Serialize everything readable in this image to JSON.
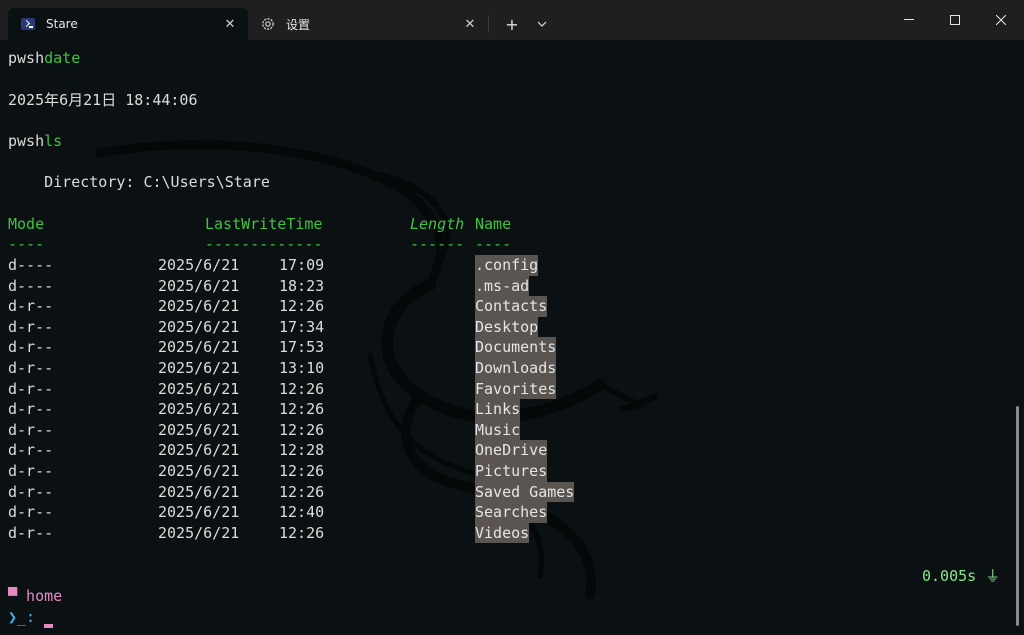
{
  "tabs": [
    {
      "title": "Stare",
      "icon": "powershell-icon"
    },
    {
      "title": "设置",
      "icon": "gear-icon"
    }
  ],
  "titlebar": {
    "new_tab": "+",
    "dropdown": "⌄"
  },
  "terminal": {
    "cmd1_prompt": "pwsh",
    "cmd1": "date",
    "date_output": "2025年6月21日 18:44:06",
    "cmd2_prompt": "pwsh",
    "cmd2": "ls",
    "directory_line": "    Directory: C:\\Users\\Stare",
    "headers": {
      "mode": "Mode",
      "lastwrite": "LastWriteTime",
      "length": "Length",
      "name": "Name"
    },
    "underlines": {
      "mode": "----",
      "lastwrite": "-------------",
      "length": "------",
      "name": "----"
    },
    "rows": [
      {
        "mode": "d----",
        "date": "2025/6/21",
        "time": "17:09",
        "name": ".config"
      },
      {
        "mode": "d----",
        "date": "2025/6/21",
        "time": "18:23",
        "name": ".ms-ad"
      },
      {
        "mode": "d-r--",
        "date": "2025/6/21",
        "time": "12:26",
        "name": "Contacts"
      },
      {
        "mode": "d-r--",
        "date": "2025/6/21",
        "time": "17:34",
        "name": "Desktop"
      },
      {
        "mode": "d-r--",
        "date": "2025/6/21",
        "time": "17:53",
        "name": "Documents"
      },
      {
        "mode": "d-r--",
        "date": "2025/6/21",
        "time": "13:10",
        "name": "Downloads"
      },
      {
        "mode": "d-r--",
        "date": "2025/6/21",
        "time": "12:26",
        "name": "Favorites"
      },
      {
        "mode": "d-r--",
        "date": "2025/6/21",
        "time": "12:26",
        "name": "Links"
      },
      {
        "mode": "d-r--",
        "date": "2025/6/21",
        "time": "12:26",
        "name": "Music"
      },
      {
        "mode": "d-r--",
        "date": "2025/6/21",
        "time": "12:28",
        "name": "OneDrive"
      },
      {
        "mode": "d-r--",
        "date": "2025/6/21",
        "time": "12:26",
        "name": "Pictures"
      },
      {
        "mode": "d-r--",
        "date": "2025/6/21",
        "time": "12:26",
        "name": "Saved Games"
      },
      {
        "mode": "d-r--",
        "date": "2025/6/21",
        "time": "12:40",
        "name": "Searches"
      },
      {
        "mode": "d-r--",
        "date": "2025/6/21",
        "time": "12:26",
        "name": "Videos"
      }
    ],
    "timer": "0.005s ⏚",
    "prompt_dir": "▀ home",
    "prompt_symbol": "❯_: "
  },
  "colors": {
    "background": "#0b1113",
    "header_green": "#3fc33f",
    "prompt_pink": "#e58ac3",
    "prompt_blue": "#3fb7e8",
    "selection": "#5a5550"
  }
}
